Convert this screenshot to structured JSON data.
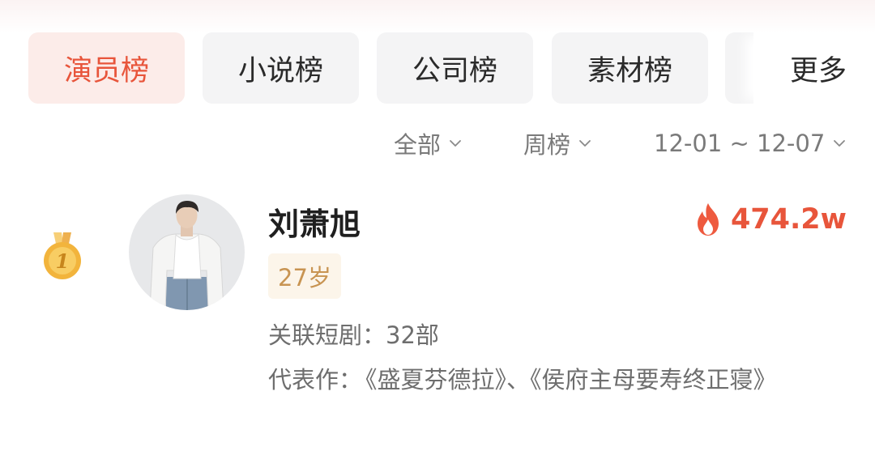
{
  "tabs": [
    {
      "label": "演员榜",
      "active": true
    },
    {
      "label": "小说榜",
      "active": false
    },
    {
      "label": "公司榜",
      "active": false
    },
    {
      "label": "素材榜",
      "active": false
    }
  ],
  "more_label": "更多",
  "filters": {
    "scope": "全部",
    "period": "周榜",
    "date_range": "12-01 ~ 12-07"
  },
  "entry": {
    "rank": 1,
    "rank_label": "1",
    "name": "刘萧旭",
    "heat": "474.2w",
    "age": "27岁",
    "linked_label": "关联短剧：",
    "linked_count": "32部",
    "works_label": "代表作：",
    "works_text": "《盛夏芬德拉》、《侯府主母要寿终正寝》"
  },
  "colors": {
    "accent": "#e8553b",
    "active_tab_bg": "#fcece9",
    "tab_bg": "#f4f4f5",
    "age_badge_bg": "#fcf5ea",
    "age_badge_text": "#c89452",
    "medal_gold": "#f2b43c"
  },
  "icons": {
    "filter_chevron": "chevron-down-icon",
    "heat": "fire-icon",
    "rank": "gold-medal-icon"
  }
}
